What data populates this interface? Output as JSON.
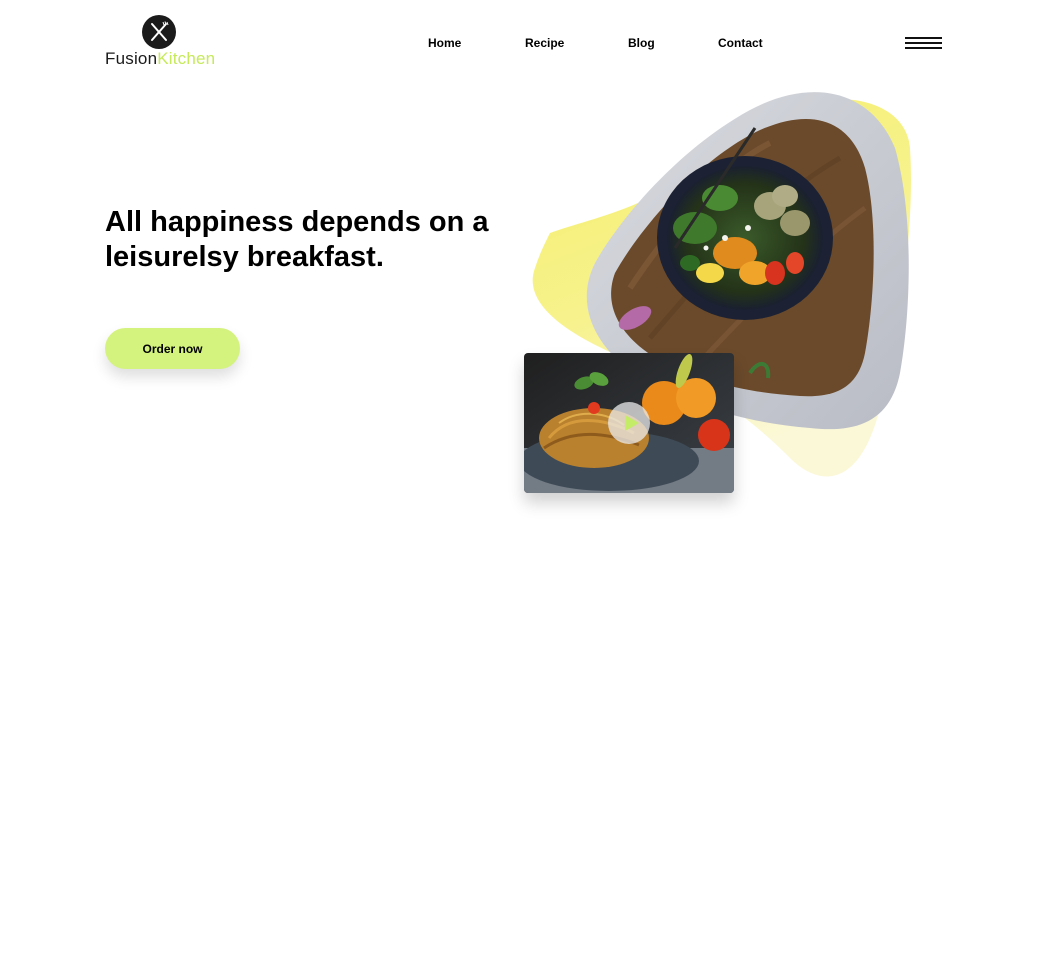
{
  "brand": {
    "name_part1": "Fusion",
    "name_part2": "Kitchen",
    "logo_icon": "fork-knife-icon",
    "accent_color": "#c6ea5a"
  },
  "nav": {
    "items": [
      {
        "label": "Home"
      },
      {
        "label": "Recipe"
      },
      {
        "label": "Blog"
      },
      {
        "label": "Contact"
      }
    ],
    "menu_icon": "hamburger-menu-icon"
  },
  "hero": {
    "headline": "All happiness depends on a leisurelsy breakfast.",
    "cta_label": "Order now",
    "cta_color": "#d4f27e",
    "blob_color": "#f5f07a",
    "frame_color": "#c8cbd2"
  },
  "video": {
    "play_icon": "play-icon",
    "play_color": "#c5ec67"
  }
}
